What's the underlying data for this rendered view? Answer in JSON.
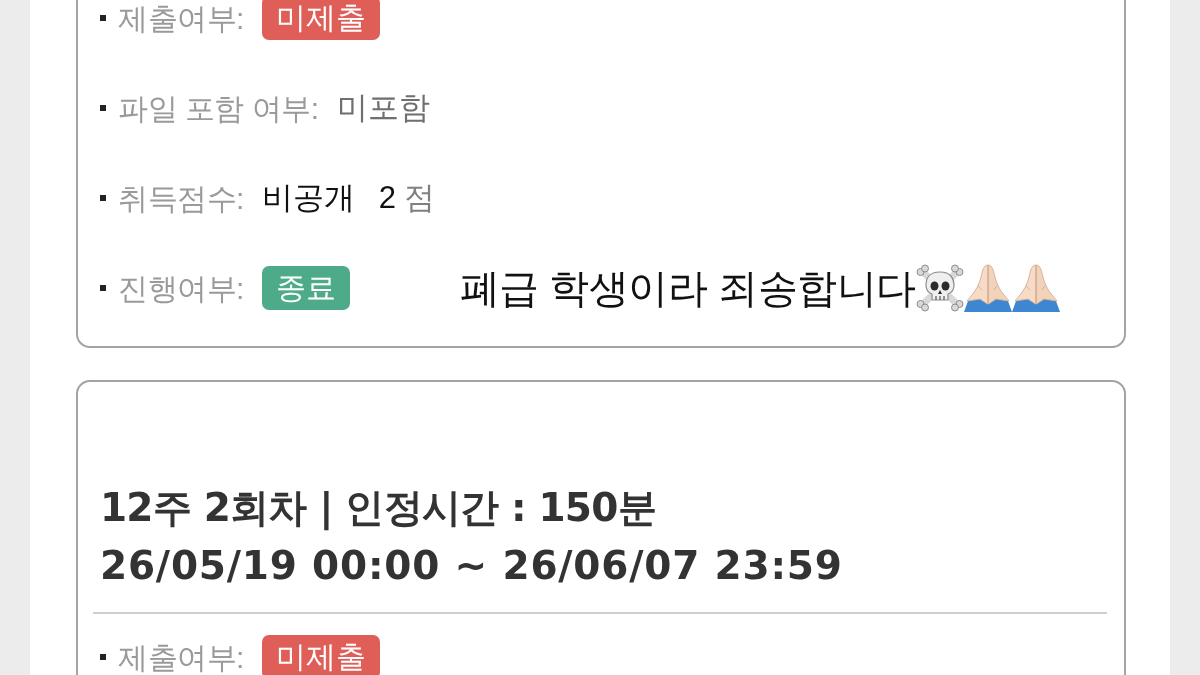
{
  "cards": [
    {
      "rows": [
        {
          "label": "제출여부:",
          "kind": "badge",
          "value": "미제출",
          "color": "#df5f58"
        },
        {
          "label": "파일 포함 여부:",
          "kind": "text",
          "value": "미포함"
        },
        {
          "label": "취득점수:",
          "kind": "score",
          "value": "비공개",
          "score": "2",
          "unit": "점"
        },
        {
          "label": "진행여부:",
          "kind": "badge",
          "value": "종료",
          "color": "#4eab8a"
        }
      ],
      "note": "폐급 학생이라 죄송합니다"
    },
    {
      "title": "12주 2회차 | 인정시간 : 150분",
      "period": "26/05/19 00:00 ~ 26/06/07 23:59",
      "rows": [
        {
          "label": "제출여부:",
          "kind": "badge",
          "value": "미제출",
          "color": "#df5f58"
        }
      ]
    }
  ]
}
